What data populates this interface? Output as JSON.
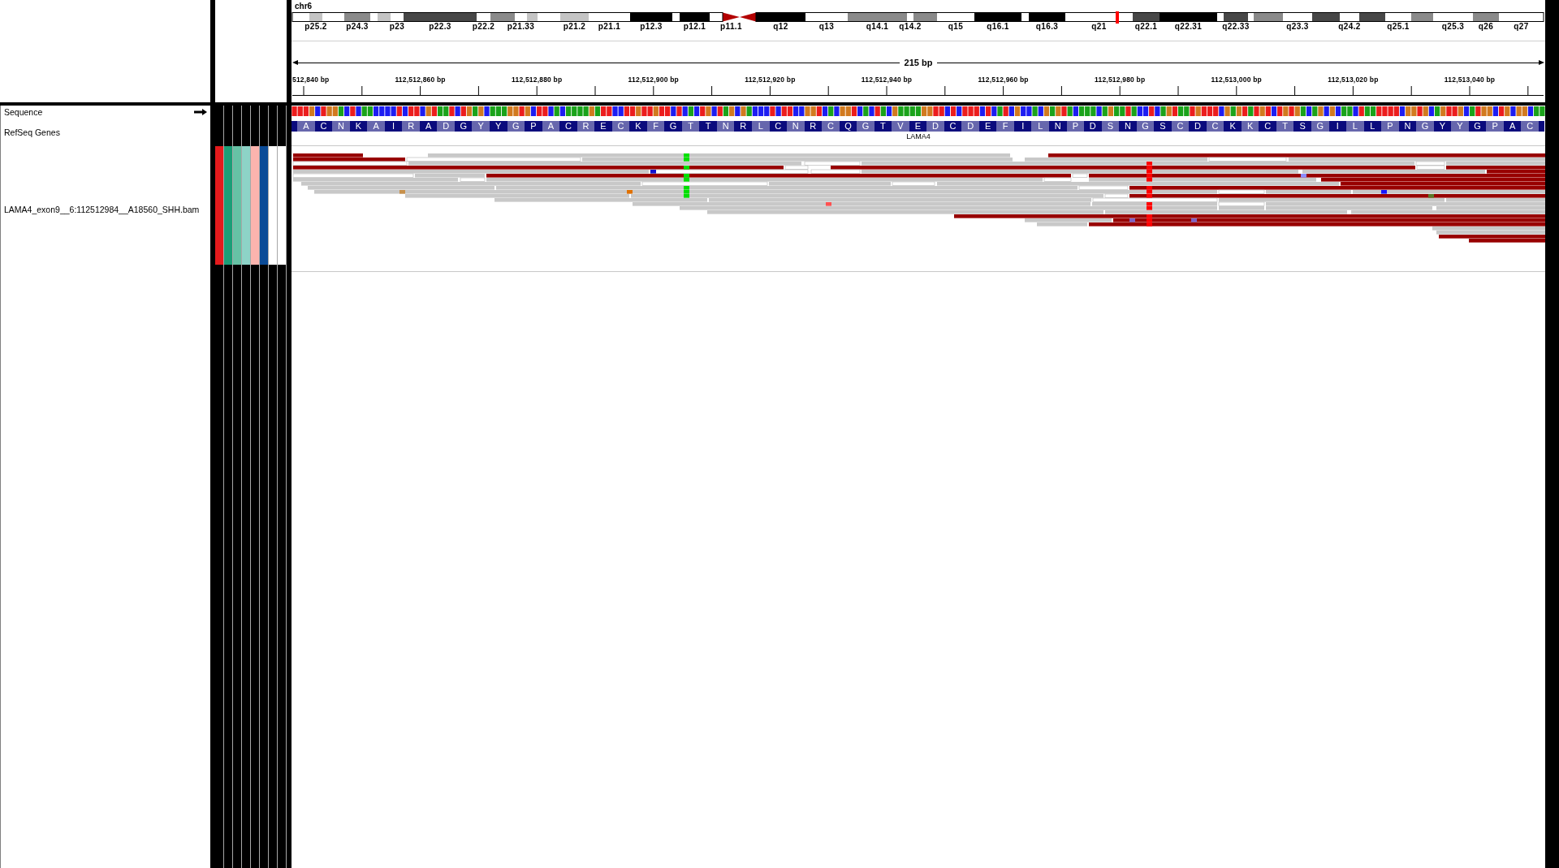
{
  "ideogram": {
    "chromosome": "chr6",
    "bands": [
      {
        "kind": "gneg"
      },
      {
        "kind": "gpos25",
        "label": "p25.2"
      },
      {
        "kind": "gneg"
      },
      {
        "kind": "gpos50",
        "label": "p24.3"
      },
      {
        "kind": "gneg"
      },
      {
        "kind": "gpos25"
      },
      {
        "kind": "gneg",
        "label": "p23"
      },
      {
        "kind": "gpos75",
        "label": "p22.3"
      },
      {
        "kind": "gneg",
        "label": "p22.2"
      },
      {
        "kind": "gpos50"
      },
      {
        "kind": "gneg",
        "label": "p21.33"
      },
      {
        "kind": "gpos25"
      },
      {
        "kind": "gneg"
      },
      {
        "kind": "gpos25",
        "label": "p21.2"
      },
      {
        "kind": "gneg",
        "label": "p21.1"
      },
      {
        "kind": "gpos100",
        "label": "p12.3"
      },
      {
        "kind": "gneg"
      },
      {
        "kind": "gpos100",
        "label": "p12.1"
      },
      {
        "kind": "gneg"
      },
      {
        "kind": "acen",
        "label": "p11.1"
      },
      {
        "kind": "acen"
      },
      {
        "kind": "gpos100",
        "label": "q12"
      },
      {
        "kind": "gneg",
        "label": "q13"
      },
      {
        "kind": "gpos50",
        "label": "q14.1"
      },
      {
        "kind": "gneg",
        "label": "q14.2"
      },
      {
        "kind": "gpos50"
      },
      {
        "kind": "gneg",
        "label": "q15"
      },
      {
        "kind": "gpos100",
        "label": "q16.1"
      },
      {
        "kind": "gneg"
      },
      {
        "kind": "gpos100",
        "label": "q16.3"
      },
      {
        "kind": "gneg",
        "label": "q21"
      },
      {
        "kind": "gpos75",
        "label": "q22.1"
      },
      {
        "kind": "gpos100",
        "label": "q22.31"
      },
      {
        "kind": "gneg"
      },
      {
        "kind": "gpos75",
        "label": "q22.33"
      },
      {
        "kind": "gneg"
      },
      {
        "kind": "gpos50"
      },
      {
        "kind": "gneg",
        "label": "q23.3"
      },
      {
        "kind": "gpos75"
      },
      {
        "kind": "gneg",
        "label": "q24.2"
      },
      {
        "kind": "gpos75"
      },
      {
        "kind": "gneg",
        "label": "q25.1"
      },
      {
        "kind": "gpos50"
      },
      {
        "kind": "gneg",
        "label": "q25.3"
      },
      {
        "kind": "gpos50",
        "label": "q26"
      },
      {
        "kind": "gneg",
        "label": "q27"
      }
    ]
  },
  "ruler": {
    "span": "215 bp",
    "ticks": [
      "512,840 bp",
      "112,512,860 bp",
      "112,512,880 bp",
      "112,512,900 bp",
      "112,512,920 bp",
      "112,512,940 bp",
      "112,512,960 bp",
      "112,512,980 bp",
      "112,513,000 bp",
      "112,513,020 bp",
      "112,513,040 bp"
    ]
  },
  "tracks": [
    {
      "kind": "sequence",
      "name": "Sequence",
      "forward_strand": true
    },
    {
      "kind": "gene",
      "name": "RefSeq Genes",
      "gene": "LAMA4",
      "amino_acids": [
        "A",
        "C",
        "N",
        "K",
        "A",
        "I",
        "R",
        "A",
        "D",
        "G",
        "Y",
        "Y",
        "G",
        "P",
        "A",
        "C",
        "R",
        "E",
        "C",
        "K",
        "F",
        "G",
        "T",
        "T",
        "N",
        "R",
        "L",
        "C",
        "N",
        "R",
        "C",
        "Q",
        "G",
        "T",
        "V",
        "E",
        "D",
        "C",
        "D",
        "E",
        "F",
        "I",
        "L",
        "N",
        "P",
        "D",
        "S",
        "N",
        "G",
        "S",
        "C",
        "D",
        "C",
        "K",
        "K",
        "C",
        "T",
        "S",
        "G",
        "I",
        "L",
        "L",
        "P",
        "N",
        "G",
        "Y",
        "Y",
        "G",
        "P",
        "A",
        "C"
      ]
    },
    {
      "kind": "alignment",
      "name": "LAMA4_exon9__6:112512984__A18560_SHH.bam",
      "attributes": [
        {
          "color": "#e41a1c"
        },
        {
          "color": "#1b9e77"
        },
        {
          "color": "#66c2a5"
        },
        {
          "color": "#8dd3c7"
        },
        {
          "color": "#fbb4ae"
        },
        {
          "color": "#0b4b97"
        },
        {
          "color": "#ffffff"
        },
        {
          "color": "#ffffff"
        }
      ]
    }
  ]
}
